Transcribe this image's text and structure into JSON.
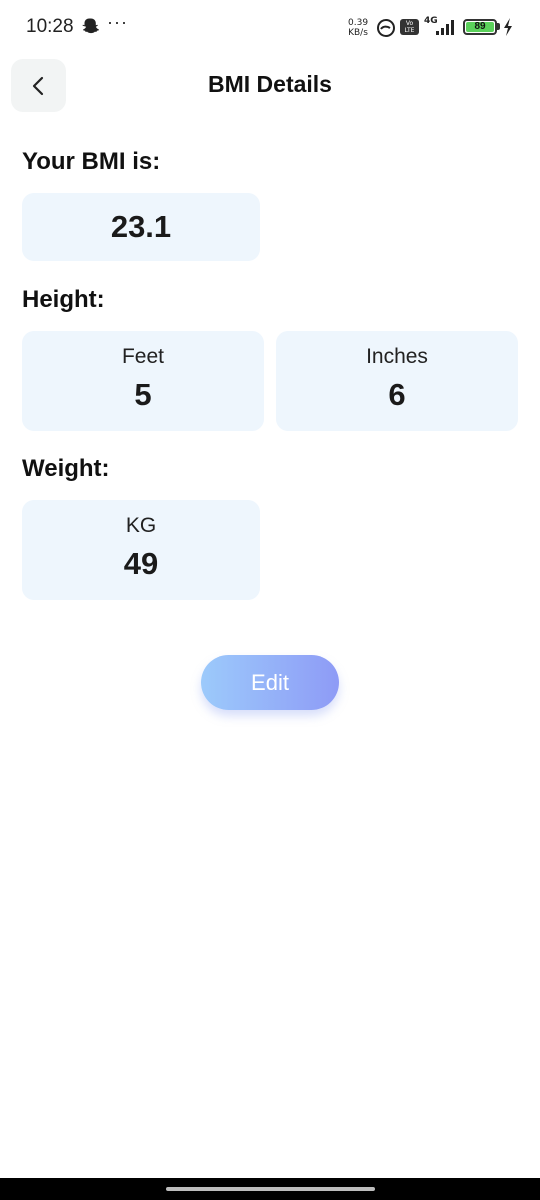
{
  "status_bar": {
    "time": "10:28",
    "more": "···",
    "net_speed_value": "0.39",
    "net_speed_unit": "KB/s",
    "volte_line1": "Vo",
    "volte_line2": "LTE",
    "network_type": "4G",
    "battery_level": "89",
    "battery_color": "#5bd15b"
  },
  "header": {
    "title": "BMI Details",
    "back_icon": "chevron-left-icon"
  },
  "bmi": {
    "label": "Your BMI is:",
    "value": "23.1"
  },
  "height": {
    "label": "Height:",
    "feet_caption": "Feet",
    "feet_value": "5",
    "inches_caption": "Inches",
    "inches_value": "6"
  },
  "weight": {
    "label": "Weight:",
    "unit_caption": "KG",
    "value": "49"
  },
  "actions": {
    "edit_label": "Edit"
  },
  "colors": {
    "card_background": "#eef6fd",
    "edit_gradient_start": "#9ccafb",
    "edit_gradient_end": "#8e9bf6"
  }
}
